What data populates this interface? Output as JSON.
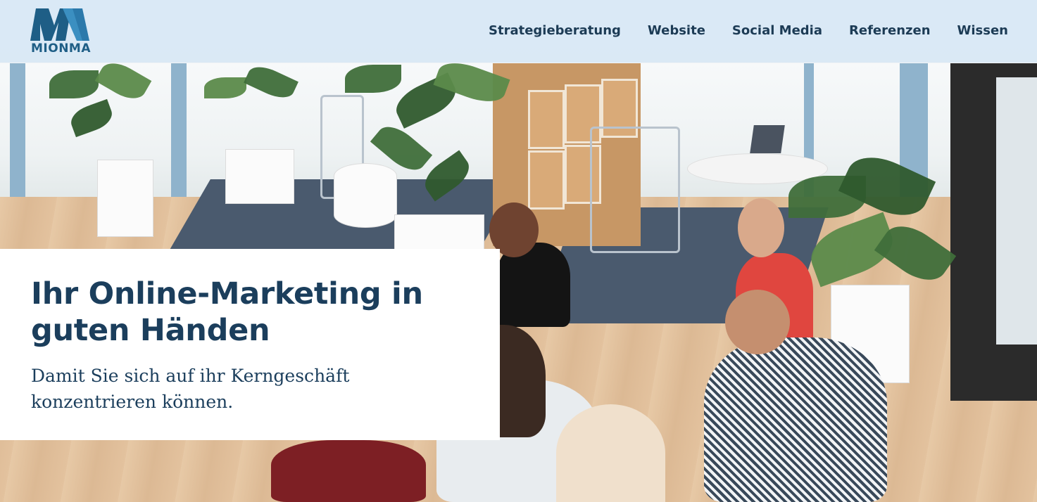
{
  "brand": {
    "logo_text": "MIONMA",
    "colors": {
      "logo_primary": "#1e5e86",
      "logo_accent": "#3b8fc1",
      "text_dark": "#1b3e5c",
      "header_bg": "#d7e8f5"
    }
  },
  "nav": {
    "items": [
      {
        "label": "Strategieberatung"
      },
      {
        "label": "Website"
      },
      {
        "label": "Social Media"
      },
      {
        "label": "Referenzen"
      },
      {
        "label": "Wissen"
      }
    ]
  },
  "hero": {
    "title": "Ihr Online-Marketing in guten Händen",
    "subtitle": "Damit Sie sich auf ihr Kerngeschäft konzentrieren können.",
    "image_icon": "office-team-meeting-photo"
  }
}
